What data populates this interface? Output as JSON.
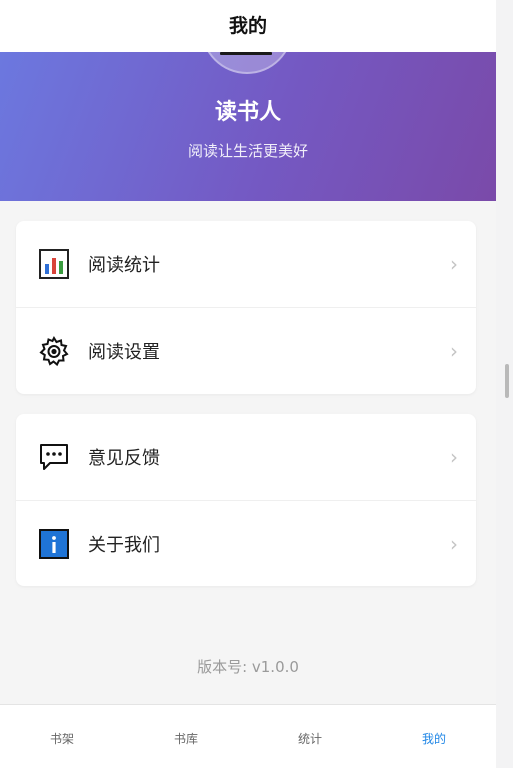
{
  "header": {
    "title": "我的"
  },
  "profile": {
    "name": "读书人",
    "tagline": "阅读让生活更美好"
  },
  "menu_groups": [
    {
      "items": [
        {
          "label": "阅读统计",
          "icon": "bar-chart-icon"
        },
        {
          "label": "阅读设置",
          "icon": "gear-icon"
        }
      ]
    },
    {
      "items": [
        {
          "label": "意见反馈",
          "icon": "speech-bubble-icon"
        },
        {
          "label": "关于我们",
          "icon": "info-icon"
        }
      ]
    }
  ],
  "chevron": "›",
  "footer": {
    "version": "版本号: v1.0.0"
  },
  "tabbar": {
    "tabs": [
      {
        "label": "书架"
      },
      {
        "label": "书库"
      },
      {
        "label": "统计"
      },
      {
        "label": "我的"
      }
    ],
    "active_index": 3
  },
  "colors": {
    "accent": "#1f86e6",
    "hero_gradient_start": "#6c78df",
    "hero_gradient_end": "#7a4aa9"
  }
}
